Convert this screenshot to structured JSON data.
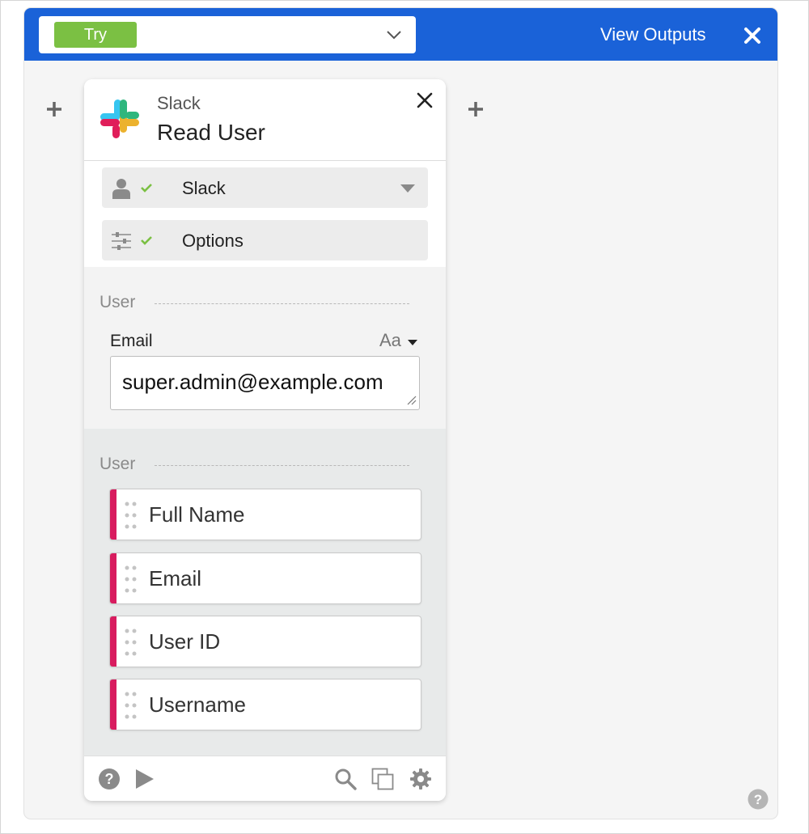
{
  "topbar": {
    "try_label": "Try",
    "view_outputs_label": "View Outputs",
    "accent_color": "#1a62d8",
    "try_color": "#7bc043"
  },
  "card": {
    "app_name": "Slack",
    "action_title": "Read User",
    "steps": [
      {
        "label": "Slack",
        "icon": "user-icon",
        "status": "check-icon",
        "control": "caret-down-icon"
      },
      {
        "label": "Options",
        "icon": "sliders-icon",
        "status": "check-icon"
      }
    ],
    "input_section": {
      "title": "User",
      "field_label": "Email",
      "format_toggle": "Aa",
      "email_value": "super.admin@example.com"
    },
    "output_section": {
      "title": "User",
      "pills": [
        "Full Name",
        "Email",
        "User ID",
        "Username"
      ],
      "pill_color": "#d81c5f"
    },
    "footer_icons": [
      "help-icon",
      "play-icon",
      "search-icon",
      "copy-icon",
      "gear-icon"
    ]
  }
}
